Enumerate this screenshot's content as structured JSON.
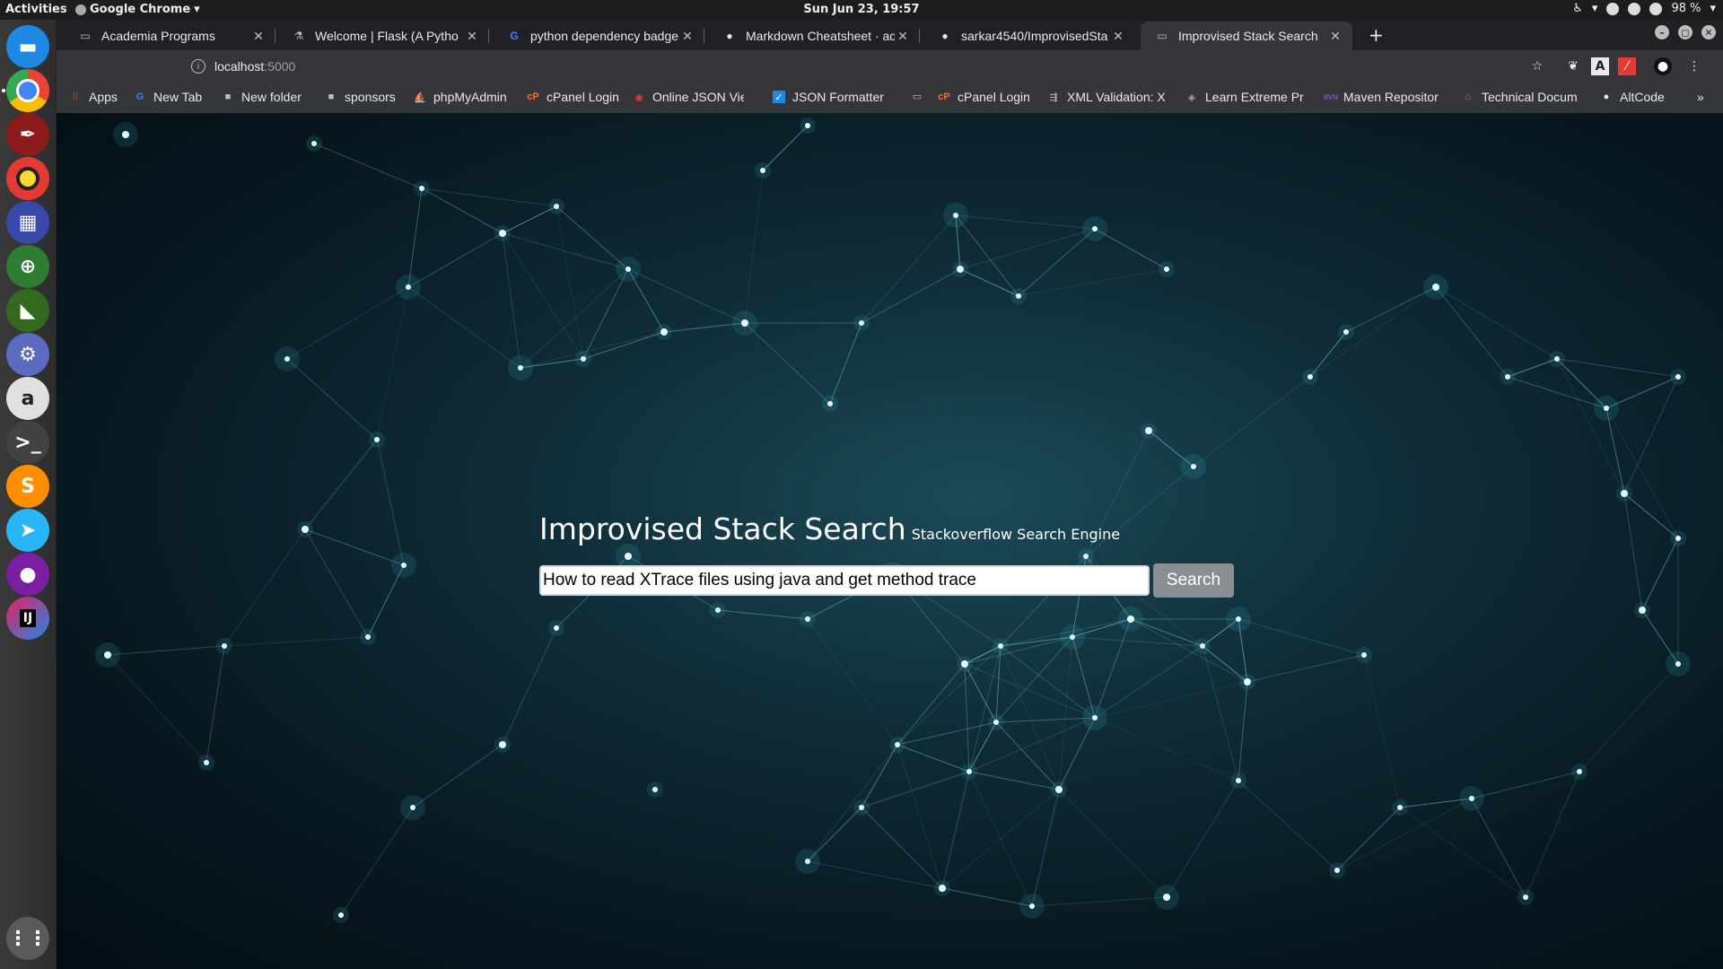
{
  "topbar": {
    "activities": "Activities",
    "app_name": "Google Chrome",
    "clock": "Sun Jun 23, 19:57",
    "battery": "98 %"
  },
  "dock": {
    "icons": [
      "files-icon",
      "chrome-icon",
      "inkscape-icon",
      "rhythmbox-icon",
      "app-grid-icon",
      "help-icon",
      "gedit-icon",
      "settings-icon",
      "amazon-icon",
      "terminal-icon",
      "sublime-icon",
      "telegram-icon",
      "pidgin-icon",
      "intellij-icon",
      "show-apps-icon"
    ]
  },
  "tabs": [
    {
      "label": "Academia Programs",
      "icon": "page-icon",
      "active": false
    },
    {
      "label": "Welcome | Flask (A Pytho",
      "icon": "flask-icon",
      "active": false
    },
    {
      "label": "python dependency badge",
      "icon": "google-icon",
      "active": false
    },
    {
      "label": "Markdown Cheatsheet · ad",
      "icon": "github-icon",
      "active": false
    },
    {
      "label": "sarkar4540/ImprovisedSta",
      "icon": "github-icon",
      "active": false
    },
    {
      "label": "Improvised Stack Search",
      "icon": "page-icon",
      "active": true
    }
  ],
  "omnibox": {
    "host": "localhost",
    "port": ":5000"
  },
  "bookmarks": [
    {
      "label": "Apps",
      "icon": "apps-icon",
      "color": "#e94235"
    },
    {
      "label": "New Tab",
      "icon": "google-icon",
      "color": "#4285f4"
    },
    {
      "label": "New folder",
      "icon": "folder-icon",
      "color": "#bdc1c6"
    },
    {
      "label": "sponsors",
      "icon": "folder-icon",
      "color": "#bdc1c6"
    },
    {
      "label": "phpMyAdmin",
      "icon": "phpmyadmin-icon",
      "color": "#f89c0e"
    },
    {
      "label": "cPanel Login",
      "icon": "cpanel-icon",
      "color": "#ff6c2c"
    },
    {
      "label": "Online JSON Vie",
      "icon": "json-viewer-icon",
      "color": "#e53935"
    },
    {
      "label": "JSON Formatter",
      "icon": "checkbox-icon",
      "color": "#1e88e5"
    },
    {
      "label": "",
      "icon": "page-icon",
      "color": "#bdc1c6"
    },
    {
      "label": "cPanel Login",
      "icon": "cpanel-icon",
      "color": "#ff6c2c"
    },
    {
      "label": "XML Validation: X",
      "icon": "xml-icon",
      "color": "#bdc1c6"
    },
    {
      "label": "Learn Extreme Pr",
      "icon": "diamond-icon",
      "color": "#9aa0a6"
    },
    {
      "label": "Maven Repositor",
      "icon": "maven-icon",
      "color": "#7e57c2"
    },
    {
      "label": "Technical Docum",
      "icon": "tech-docs-icon",
      "color": "#e57373"
    },
    {
      "label": "AltCode",
      "icon": "github-icon",
      "color": "#e8eaed"
    }
  ],
  "page": {
    "title": "Improvised Stack Search",
    "tagline": "Stackoverflow Search Engine",
    "search_value": "How to read XTrace files using java and get method trace",
    "search_button": "Search"
  },
  "colors": {
    "accent_button": "#8a8f93",
    "network_line": "#8fe3ee",
    "background_dark": "#081820"
  }
}
